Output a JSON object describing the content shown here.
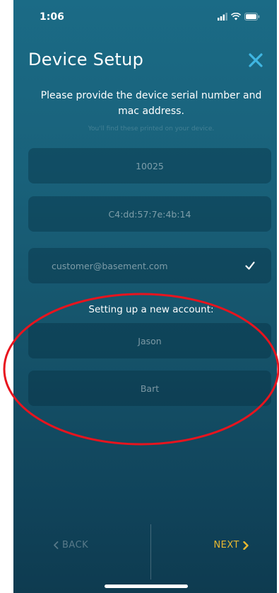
{
  "status_bar": {
    "time": "1:06",
    "icons": [
      "signal-icon",
      "wifi-icon",
      "battery-icon"
    ]
  },
  "header": {
    "title": "Device Setup",
    "close_icon": "close-icon"
  },
  "instructions": {
    "text": "Please provide the device serial number and mac address.",
    "hint": "You'll find these printed on your device."
  },
  "fields": {
    "serial_number": "10025",
    "mac_address": "C4:dd:57:7e:4b:14",
    "email": "customer@basement.com"
  },
  "new_account": {
    "label": "Setting up a new account:",
    "first_name": "Jason",
    "last_name": "Bart"
  },
  "nav": {
    "back_label": "BACK",
    "next_label": "NEXT"
  },
  "colors": {
    "accent_close": "#3fb6e2",
    "accent_next": "#e8b830",
    "annotation": "#e8141e",
    "background_top": "#1b6b86",
    "background_bottom": "#0e3b50"
  }
}
